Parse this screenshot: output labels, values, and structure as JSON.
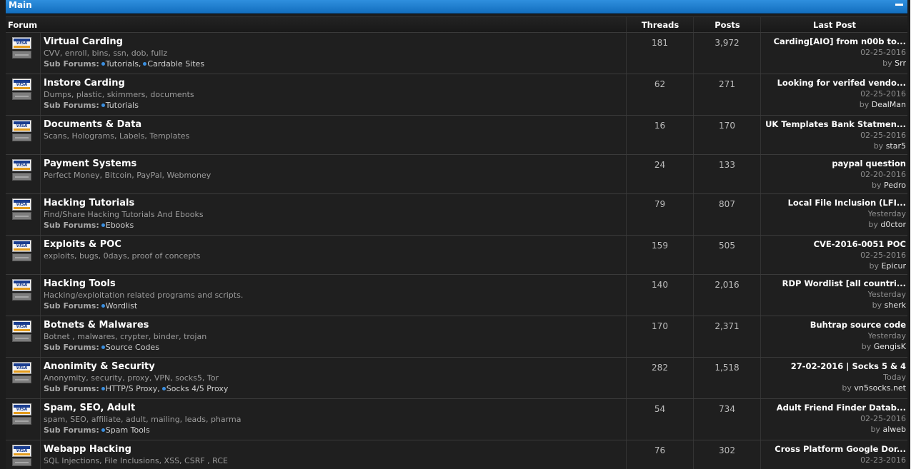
{
  "category": {
    "title": "Main"
  },
  "headers": {
    "forum": "Forum",
    "threads": "Threads",
    "posts": "Posts",
    "last_post": "Last Post"
  },
  "icon_card_text": "VISA",
  "sub_forums_label": "Sub Forums:",
  "by_label": "by",
  "forums": [
    {
      "name": "Virtual Carding",
      "desc": "CVV, enroll, bins, ssn, dob, fullz",
      "subs": [
        "Tutorials",
        "Cardable Sites"
      ],
      "threads": "181",
      "posts": "3,972",
      "last_title": "Carding[AIO] from n00b to...",
      "last_date": "02-25-2016",
      "last_user": "Srr"
    },
    {
      "name": "Instore Carding",
      "desc": "Dumps, plastic, skimmers, documents",
      "subs": [
        "Tutorials"
      ],
      "threads": "62",
      "posts": "271",
      "last_title": "Looking for verifed vendo...",
      "last_date": "02-25-2016",
      "last_user": "DealMan"
    },
    {
      "name": "Documents & Data",
      "desc": "Scans, Holograms, Labels, Templates",
      "subs": [],
      "threads": "16",
      "posts": "170",
      "last_title": "UK Templates Bank Statmen...",
      "last_date": "02-25-2016",
      "last_user": "star5"
    },
    {
      "name": "Payment Systems",
      "desc": "Perfect Money, Bitcoin, PayPal, Webmoney",
      "subs": [],
      "threads": "24",
      "posts": "133",
      "last_title": "paypal question",
      "last_date": "02-20-2016",
      "last_user": "Pedro"
    },
    {
      "name": "Hacking Tutorials",
      "desc": "Find/Share Hacking Tutorials And Ebooks",
      "subs": [
        "Ebooks"
      ],
      "threads": "79",
      "posts": "807",
      "last_title": "Local File Inclusion (LFI...",
      "last_date": "Yesterday",
      "last_user": "d0ctor"
    },
    {
      "name": "Exploits & POC",
      "desc": "exploits, bugs, 0days, proof of concepts",
      "subs": [],
      "threads": "159",
      "posts": "505",
      "last_title": "CVE-2016-0051 POC",
      "last_date": "02-25-2016",
      "last_user": "Epicur"
    },
    {
      "name": "Hacking Tools",
      "desc": "Hacking/exploitation related programs and scripts.",
      "subs": [
        "Wordlist"
      ],
      "threads": "140",
      "posts": "2,016",
      "last_title": "RDP Wordlist [all countri...",
      "last_date": "Yesterday",
      "last_user": "sherk"
    },
    {
      "name": "Botnets & Malwares",
      "desc": "Botnet , malwares, crypter, binder, trojan",
      "subs": [
        "Source Codes"
      ],
      "threads": "170",
      "posts": "2,371",
      "last_title": "Buhtrap source code",
      "last_date": "Yesterday",
      "last_user": "GengisK"
    },
    {
      "name": "Anonimity & Security",
      "desc": "Anonymity, security, proxy, VPN, socks5, Tor",
      "subs": [
        "HTTP/S Proxy",
        "Socks 4/5 Proxy"
      ],
      "threads": "282",
      "posts": "1,518",
      "last_title": "27-02-2016 | Socks 5 & 4",
      "last_date": "Today",
      "last_user": "vn5socks.net"
    },
    {
      "name": "Spam, SEO, Adult",
      "desc": "spam, SEO, affiliate, adult, mailing, leads, pharma",
      "subs": [
        "Spam Tools"
      ],
      "threads": "54",
      "posts": "734",
      "last_title": "Adult Friend Finder Datab...",
      "last_date": "02-25-2016",
      "last_user": "alweb"
    },
    {
      "name": "Webapp Hacking",
      "desc": "SQL Injections, File Inclusions, XSS, CSRF , RCE",
      "subs": [],
      "threads": "76",
      "posts": "302",
      "last_title": "Cross Platform Google Dor...",
      "last_date": "02-23-2016",
      "last_user": ""
    }
  ]
}
